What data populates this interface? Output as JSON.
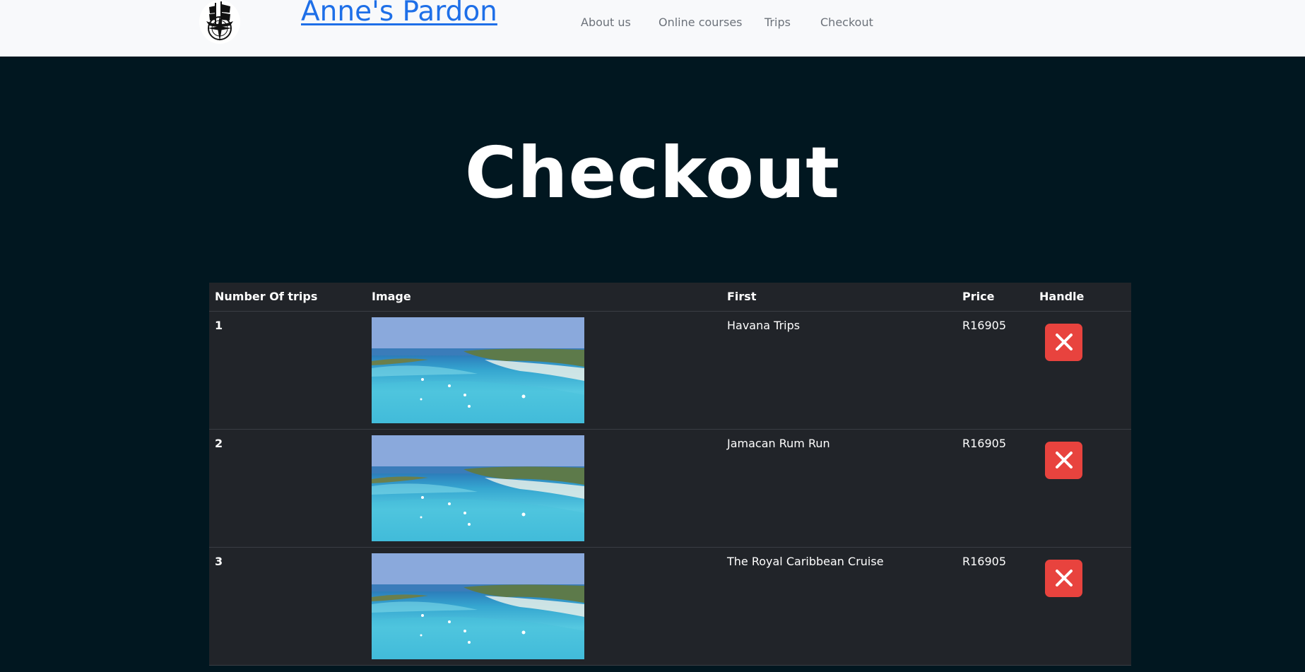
{
  "navbar": {
    "logo": "ship-compass-logo",
    "brand": "Anne's Pardon",
    "links": [
      "About us",
      "Online courses",
      "Trips",
      "Checkout"
    ]
  },
  "hero": {
    "title": "Checkout"
  },
  "table": {
    "headers": [
      "Number Of trips",
      "Image",
      "First",
      "Price",
      "Handle"
    ],
    "rows": [
      {
        "number": "1",
        "image": "aerial-lagoon-photo",
        "first": "Havana Trips",
        "price": "R16905",
        "handle_icon": "close-icon"
      },
      {
        "number": "2",
        "image": "aerial-lagoon-photo",
        "first": "Jamacan Rum Run",
        "price": "R16905",
        "handle_icon": "close-icon"
      },
      {
        "number": "3",
        "image": "aerial-lagoon-photo",
        "first": "The Royal Caribbean Cruise",
        "price": "R16905",
        "handle_icon": "close-icon"
      }
    ]
  },
  "colors": {
    "page_bg": "#011720",
    "navbar_bg": "#f8f9fb",
    "brand_link": "#1e6fe8",
    "table_bg": "#212429",
    "delete_button": "#e8433e"
  }
}
